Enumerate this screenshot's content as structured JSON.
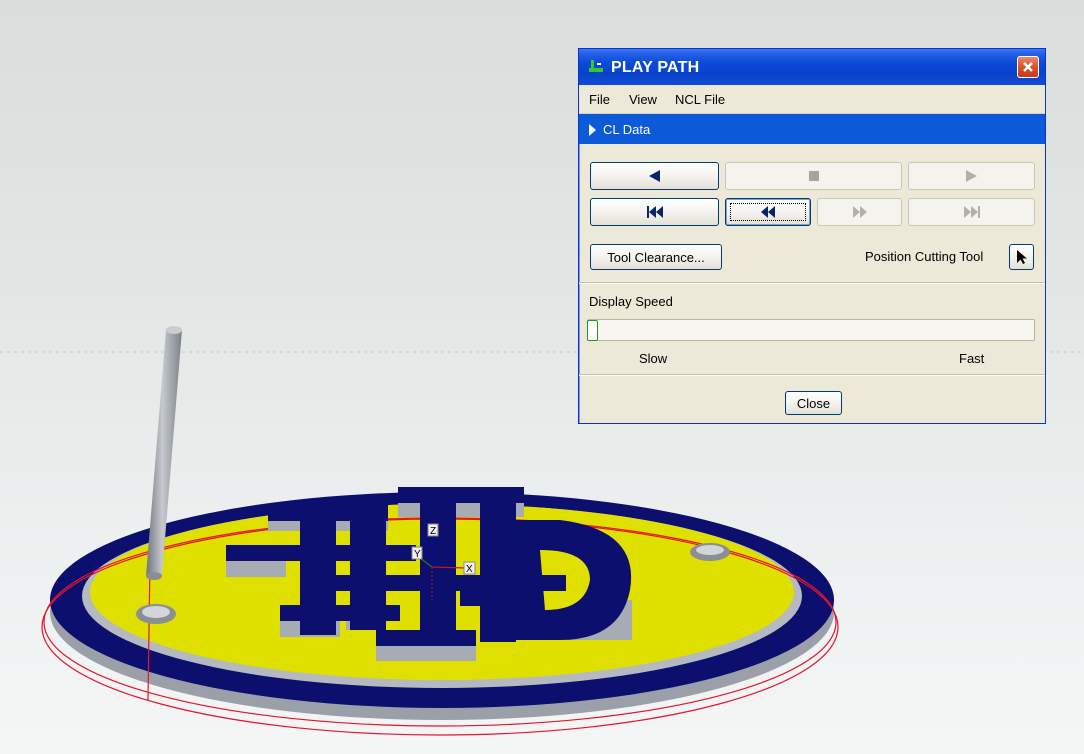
{
  "dialog": {
    "title": "PLAY PATH",
    "menu": [
      "File",
      "View",
      "NCL File"
    ],
    "cl_data_label": "CL Data",
    "controls": {
      "row1": [
        "step-back",
        "stop",
        "play"
      ],
      "row2": [
        "rewind-to-start",
        "step-back-fast",
        "step-forward-fast",
        "forward-to-end"
      ]
    },
    "tool_clearance_label": "Tool Clearance...",
    "position_cutting_tool_label": "Position Cutting Tool",
    "display_speed_label": "Display Speed",
    "speed_value": 0.0,
    "slow_label": "Slow",
    "fast_label": "Fast",
    "close_label": "Close"
  },
  "viewport": {
    "axis_labels": {
      "z": "Z",
      "y": "Y",
      "x": "X"
    },
    "colors": {
      "plate": "#e0e000",
      "raised": "#0c0f6e",
      "side": "#a9adb6",
      "toolpath": "#e3142e",
      "tool": "#9da2a8"
    }
  }
}
